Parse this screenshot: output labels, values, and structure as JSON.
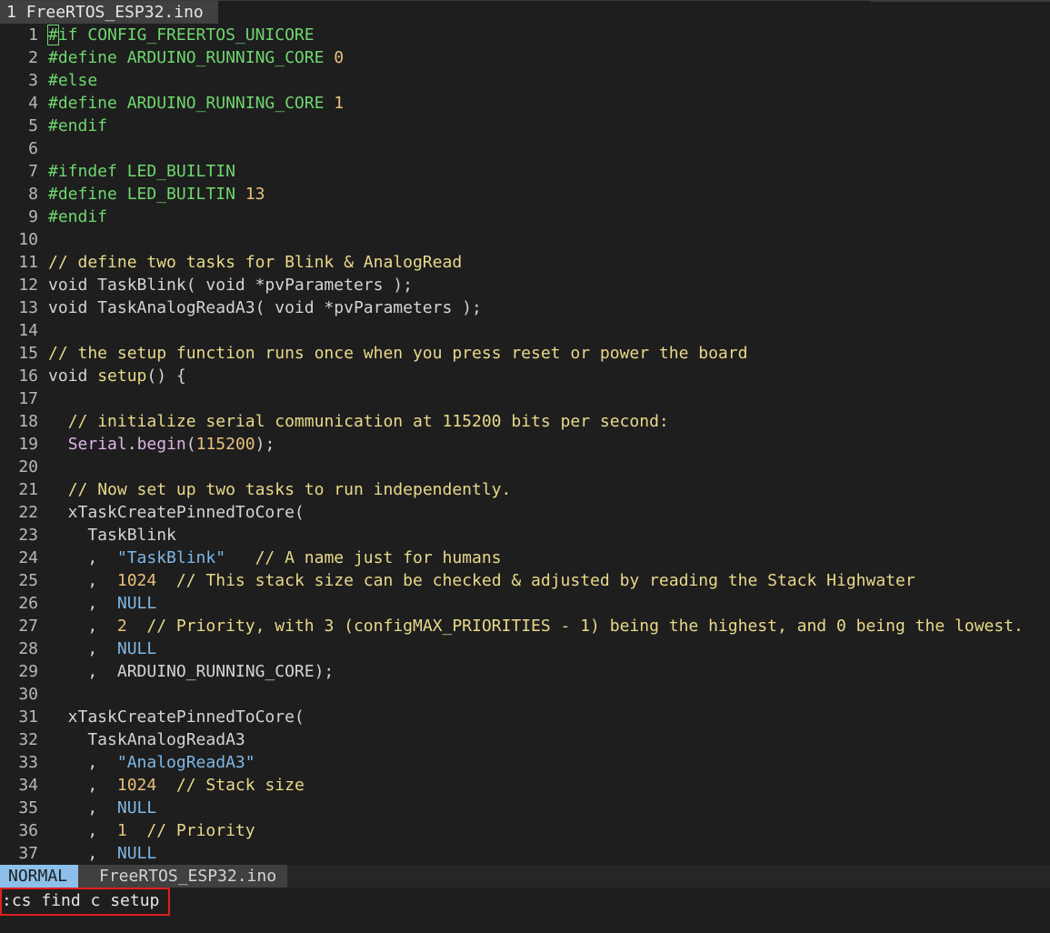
{
  "tabline": {
    "tab_number": "1",
    "tab_title": "FreeRTOS_ESP32.ino"
  },
  "statusline": {
    "mode": "NORMAL",
    "filename": "FreeRTOS_ESP32.ino"
  },
  "cmdline": {
    "command": ":cs find c setup"
  },
  "colors": {
    "preprocessor": "#6fd66f",
    "comment": "#e8d98a",
    "string": "#7fb7e6",
    "number": "#e8c07a",
    "mode_bg": "#8cc0ea",
    "highlight_box": "#e02020"
  },
  "lines": [
    {
      "n": "1",
      "seg": [
        [
          "pp",
          "#if CONFIG_FREERTOS_UNICORE"
        ]
      ]
    },
    {
      "n": "2",
      "seg": [
        [
          "pp",
          "#define ARDUINO_RUNNING_CORE "
        ],
        [
          "num",
          "0"
        ]
      ]
    },
    {
      "n": "3",
      "seg": [
        [
          "pp",
          "#else"
        ]
      ]
    },
    {
      "n": "4",
      "seg": [
        [
          "pp",
          "#define ARDUINO_RUNNING_CORE "
        ],
        [
          "num",
          "1"
        ]
      ]
    },
    {
      "n": "5",
      "seg": [
        [
          "pp",
          "#endif"
        ]
      ]
    },
    {
      "n": "6",
      "seg": []
    },
    {
      "n": "7",
      "seg": [
        [
          "pp",
          "#ifndef LED_BUILTIN"
        ]
      ]
    },
    {
      "n": "8",
      "seg": [
        [
          "pp",
          "#define LED_BUILTIN "
        ],
        [
          "num",
          "13"
        ]
      ]
    },
    {
      "n": "9",
      "seg": [
        [
          "pp",
          "#endif"
        ]
      ]
    },
    {
      "n": "10",
      "seg": []
    },
    {
      "n": "11",
      "seg": [
        [
          "cm",
          "// define two tasks for Blink & AnalogRead"
        ]
      ]
    },
    {
      "n": "12",
      "seg": [
        [
          "kw",
          "void TaskBlink( void *pvParameters );"
        ]
      ]
    },
    {
      "n": "13",
      "seg": [
        [
          "kw",
          "void TaskAnalogReadA3( void *pvParameters );"
        ]
      ]
    },
    {
      "n": "14",
      "seg": []
    },
    {
      "n": "15",
      "seg": [
        [
          "cm",
          "// the setup function runs once when you press reset or power the board"
        ]
      ]
    },
    {
      "n": "16",
      "seg": [
        [
          "kw",
          "void "
        ],
        [
          "fn",
          "setup"
        ],
        [
          "kw",
          "() {"
        ]
      ]
    },
    {
      "n": "17",
      "seg": []
    },
    {
      "n": "18",
      "seg": [
        [
          "kw",
          "  "
        ],
        [
          "cm",
          "// initialize serial communication at 115200 bits per second:"
        ]
      ]
    },
    {
      "n": "19",
      "seg": [
        [
          "kw",
          "  "
        ],
        [
          "obj",
          "Serial"
        ],
        [
          "kw",
          "."
        ],
        [
          "obj",
          "begin"
        ],
        [
          "kw",
          "("
        ],
        [
          "num",
          "115200"
        ],
        [
          "kw",
          ");"
        ]
      ]
    },
    {
      "n": "20",
      "seg": []
    },
    {
      "n": "21",
      "seg": [
        [
          "kw",
          "  "
        ],
        [
          "cm",
          "// Now set up two tasks to run independently."
        ]
      ]
    },
    {
      "n": "22",
      "seg": [
        [
          "kw",
          "  xTaskCreatePinnedToCore("
        ]
      ]
    },
    {
      "n": "23",
      "seg": [
        [
          "kw",
          "    TaskBlink"
        ]
      ]
    },
    {
      "n": "24",
      "seg": [
        [
          "kw",
          "    ,  "
        ],
        [
          "str",
          "\"TaskBlink\""
        ],
        [
          "kw",
          "   "
        ],
        [
          "cm",
          "// A name just for humans"
        ]
      ]
    },
    {
      "n": "25",
      "seg": [
        [
          "kw",
          "    ,  "
        ],
        [
          "num",
          "1024"
        ],
        [
          "kw",
          "  "
        ],
        [
          "cm",
          "// This stack size can be checked & adjusted by reading the Stack Highwater"
        ]
      ]
    },
    {
      "n": "26",
      "seg": [
        [
          "kw",
          "    ,  "
        ],
        [
          "const",
          "NULL"
        ]
      ]
    },
    {
      "n": "27",
      "seg": [
        [
          "kw",
          "    ,  "
        ],
        [
          "num",
          "2"
        ],
        [
          "kw",
          "  "
        ],
        [
          "cm",
          "// Priority, with 3 (configMAX_PRIORITIES - 1) being the highest, and 0 being the lowest."
        ]
      ]
    },
    {
      "n": "28",
      "seg": [
        [
          "kw",
          "    ,  "
        ],
        [
          "const",
          "NULL"
        ]
      ]
    },
    {
      "n": "29",
      "seg": [
        [
          "kw",
          "    ,  ARDUINO_RUNNING_CORE);"
        ]
      ]
    },
    {
      "n": "30",
      "seg": []
    },
    {
      "n": "31",
      "seg": [
        [
          "kw",
          "  xTaskCreatePinnedToCore("
        ]
      ]
    },
    {
      "n": "32",
      "seg": [
        [
          "kw",
          "    TaskAnalogReadA3"
        ]
      ]
    },
    {
      "n": "33",
      "seg": [
        [
          "kw",
          "    ,  "
        ],
        [
          "str",
          "\"AnalogReadA3\""
        ]
      ]
    },
    {
      "n": "34",
      "seg": [
        [
          "kw",
          "    ,  "
        ],
        [
          "num",
          "1024"
        ],
        [
          "kw",
          "  "
        ],
        [
          "cm",
          "// Stack size"
        ]
      ]
    },
    {
      "n": "35",
      "seg": [
        [
          "kw",
          "    ,  "
        ],
        [
          "const",
          "NULL"
        ]
      ]
    },
    {
      "n": "36",
      "seg": [
        [
          "kw",
          "    ,  "
        ],
        [
          "num",
          "1"
        ],
        [
          "kw",
          "  "
        ],
        [
          "cm",
          "// Priority"
        ]
      ]
    },
    {
      "n": "37",
      "seg": [
        [
          "kw",
          "    ,  "
        ],
        [
          "const",
          "NULL"
        ]
      ]
    }
  ]
}
